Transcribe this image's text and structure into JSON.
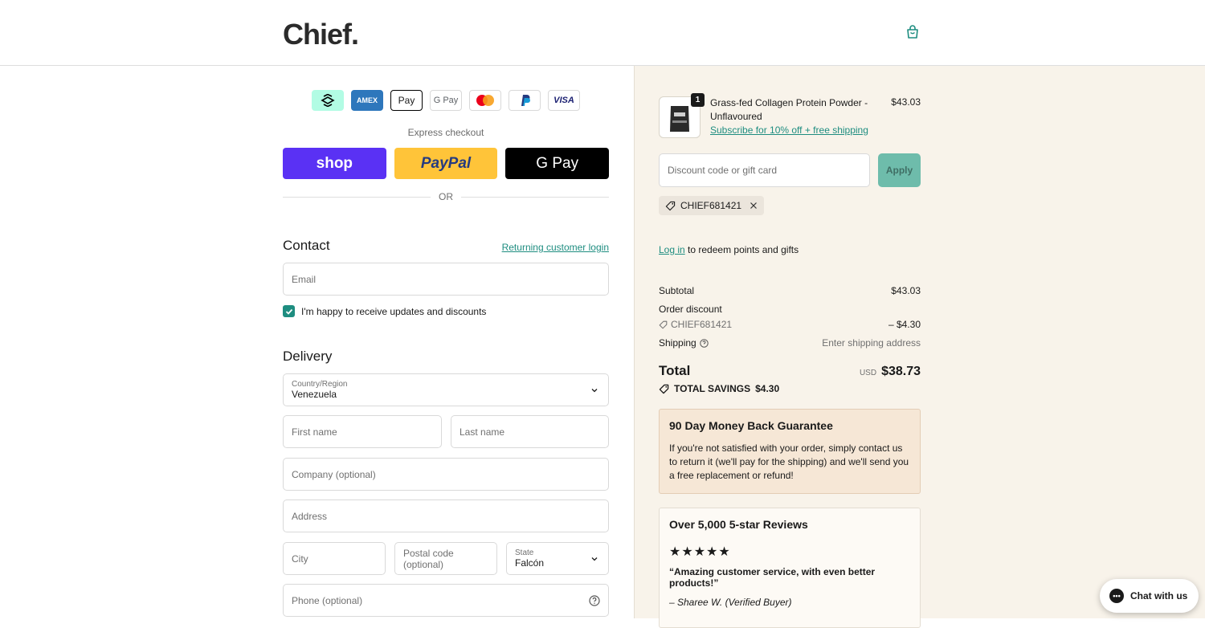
{
  "header": {
    "logo": "Chief.",
    "cart_icon": "shopping-bag-icon"
  },
  "express": {
    "payment_icons": [
      "Afterpay",
      "AMEX",
      "Apple Pay",
      "G Pay",
      "Mastercard",
      "PayPal",
      "VISA"
    ],
    "pay_labels": {
      "afterpay": "",
      "amex": "AMEX",
      "applepay": "Pay",
      "gpay": "G Pay",
      "visa": "VISA"
    },
    "label": "Express checkout",
    "shop_label": "shop",
    "paypal_label": "PayPal",
    "gpay_label": "G Pay",
    "or_label": "OR"
  },
  "contact": {
    "title": "Contact",
    "returning_login": "Returning customer login",
    "email_placeholder": "Email",
    "newsletter_label": "I'm happy to receive updates and discounts",
    "newsletter_checked": true
  },
  "delivery": {
    "title": "Delivery",
    "country_label": "Country/Region",
    "country_value": "Venezuela",
    "first_name_placeholder": "First name",
    "last_name_placeholder": "Last name",
    "company_placeholder": "Company (optional)",
    "address_placeholder": "Address",
    "city_placeholder": "City",
    "postal_placeholder": "Postal code (optional)",
    "state_label": "State",
    "state_value": "Falcón",
    "phone_placeholder": "Phone (optional)"
  },
  "order": {
    "product_name": "Grass-fed Collagen Protein Powder - Unflavoured",
    "product_link": "Subscribe for 10% off + free shipping",
    "product_price": "$43.03",
    "quantity": "1",
    "discount_placeholder": "Discount code or gift card",
    "apply_label": "Apply",
    "applied_code": "CHIEF681421",
    "login_link": "Log in",
    "login_text": " to redeem points and gifts",
    "subtotal_label": "Subtotal",
    "subtotal_value": "$43.03",
    "order_discount_label": "Order discount",
    "discount_code": "CHIEF681421",
    "discount_value": "– $4.30",
    "shipping_label": "Shipping",
    "shipping_value": "Enter shipping address",
    "total_label": "Total",
    "total_currency": "USD",
    "total_value": "$38.73",
    "savings_label": "TOTAL SAVINGS",
    "savings_value": "$4.30"
  },
  "guarantee": {
    "title": "90 Day Money Back Guarantee",
    "body": "If you're not satisfied with your order, simply contact us to return it (we'll pay for the shipping) and we'll send you a free replacement or refund!"
  },
  "reviews": {
    "title": "Over 5,000 5-star Reviews",
    "stars": "★★★★★",
    "rating": 5,
    "quote": "“Amazing customer service, with even better products!”",
    "reviewer": "– Sharee W. (Verified Buyer)"
  },
  "chat": {
    "label": "Chat with us"
  },
  "colors": {
    "accent": "#1e8d80",
    "shop": "#5a31f4",
    "paypal": "#ffc439",
    "sidebar_bg": "#f8f3ea"
  }
}
